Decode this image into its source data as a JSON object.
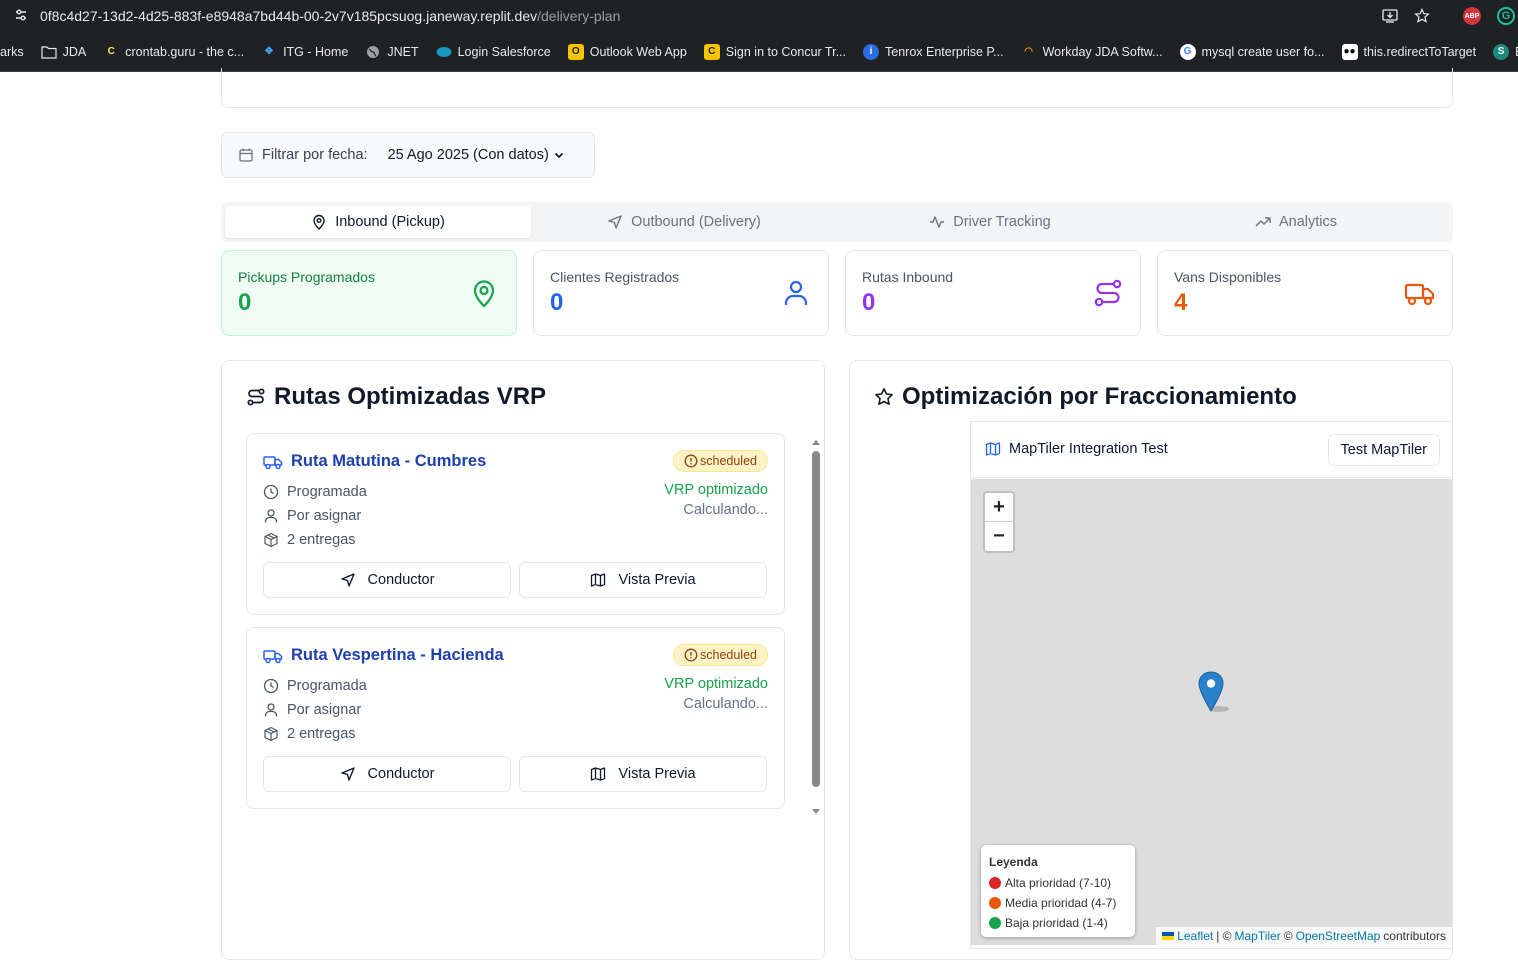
{
  "browser": {
    "url_host": "0f8c4d27-13d2-4d25-883f-e8948a7bd44b-00-2v7v185pcsuog.janeway.replit.dev",
    "url_path": "/delivery-plan",
    "bookmarks": [
      {
        "label": "arks",
        "icon": "none"
      },
      {
        "label": "JDA",
        "icon": "folder-icon"
      },
      {
        "label": "crontab.guru - the c...",
        "icon": "crontab-icon"
      },
      {
        "label": "ITG - Home",
        "icon": "itg-icon"
      },
      {
        "label": "JNET",
        "icon": "globe-icon"
      },
      {
        "label": "Login  Salesforce",
        "icon": "salesforce-icon"
      },
      {
        "label": "Outlook Web App",
        "icon": "outlook-icon"
      },
      {
        "label": "Sign in to Concur Tr...",
        "icon": "concur-icon"
      },
      {
        "label": "Tenrox Enterprise P...",
        "icon": "tenrox-icon"
      },
      {
        "label": "Workday JDA Softw...",
        "icon": "workday-icon"
      },
      {
        "label": "mysql create user fo...",
        "icon": "google-icon"
      },
      {
        "label": "this.redirectToTarget",
        "icon": "medium-icon"
      },
      {
        "label": "Escalation",
        "icon": "escalation-icon"
      }
    ]
  },
  "filter": {
    "label": "Filtrar por fecha:",
    "selected": "25 Ago 2025 (Con datos)"
  },
  "tabs": [
    {
      "label": "Inbound (Pickup)",
      "icon": "map-pin-icon",
      "active": true
    },
    {
      "label": "Outbound (Delivery)",
      "icon": "navigation-icon",
      "active": false
    },
    {
      "label": "Driver Tracking",
      "icon": "activity-icon",
      "active": false
    },
    {
      "label": "Analytics",
      "icon": "trending-up-icon",
      "active": false
    }
  ],
  "stats": [
    {
      "title": "Pickups Programados",
      "value": "0",
      "color": "#16a34a",
      "icon": "map-pin-icon"
    },
    {
      "title": "Clientes Registrados",
      "value": "0",
      "color": "#2563eb",
      "icon": "user-icon"
    },
    {
      "title": "Rutas Inbound",
      "value": "0",
      "color": "#9333ea",
      "icon": "route-icon"
    },
    {
      "title": "Vans Disponibles",
      "value": "4",
      "color": "#ea580c",
      "icon": "truck-icon"
    }
  ],
  "routes_panel": {
    "title": "Rutas Optimizadas VRP",
    "routes": [
      {
        "name": "Ruta Matutina - Cumbres",
        "badge": "scheduled",
        "status": "Programada",
        "driver": "Por asignar",
        "deliveries": "2 entregas",
        "vrp": "VRP optimizado",
        "calc": "Calculando...",
        "btn_driver": "Conductor",
        "btn_preview": "Vista Previa"
      },
      {
        "name": "Ruta Vespertina - Hacienda",
        "badge": "scheduled",
        "status": "Programada",
        "driver": "Por asignar",
        "deliveries": "2 entregas",
        "vrp": "VRP optimizado",
        "calc": "Calculando...",
        "btn_driver": "Conductor",
        "btn_preview": "Vista Previa"
      }
    ]
  },
  "map_panel": {
    "title": "Optimización por Fraccionamiento",
    "map_title": "MapTiler Integration Test",
    "test_button": "Test MapTiler",
    "zoom_in": "+",
    "zoom_out": "−",
    "legend": {
      "title": "Leyenda",
      "items": [
        {
          "label": "Alta prioridad (7-10)",
          "color": "#dc2626"
        },
        {
          "label": "Media prioridad (4-7)",
          "color": "#ea580c"
        },
        {
          "label": "Baja prioridad (1-4)",
          "color": "#16a34a"
        }
      ]
    },
    "attribution": {
      "leaflet": "Leaflet",
      "sep1": "| ©",
      "maptiler": "MapTiler",
      "sep2": "©",
      "osm": "OpenStreetMap",
      "contributors": "contributors"
    }
  },
  "colors": {
    "accent_blue": "#1e40af",
    "badge_bg": "#fef3c7",
    "vrp_green": "#16a34a"
  }
}
